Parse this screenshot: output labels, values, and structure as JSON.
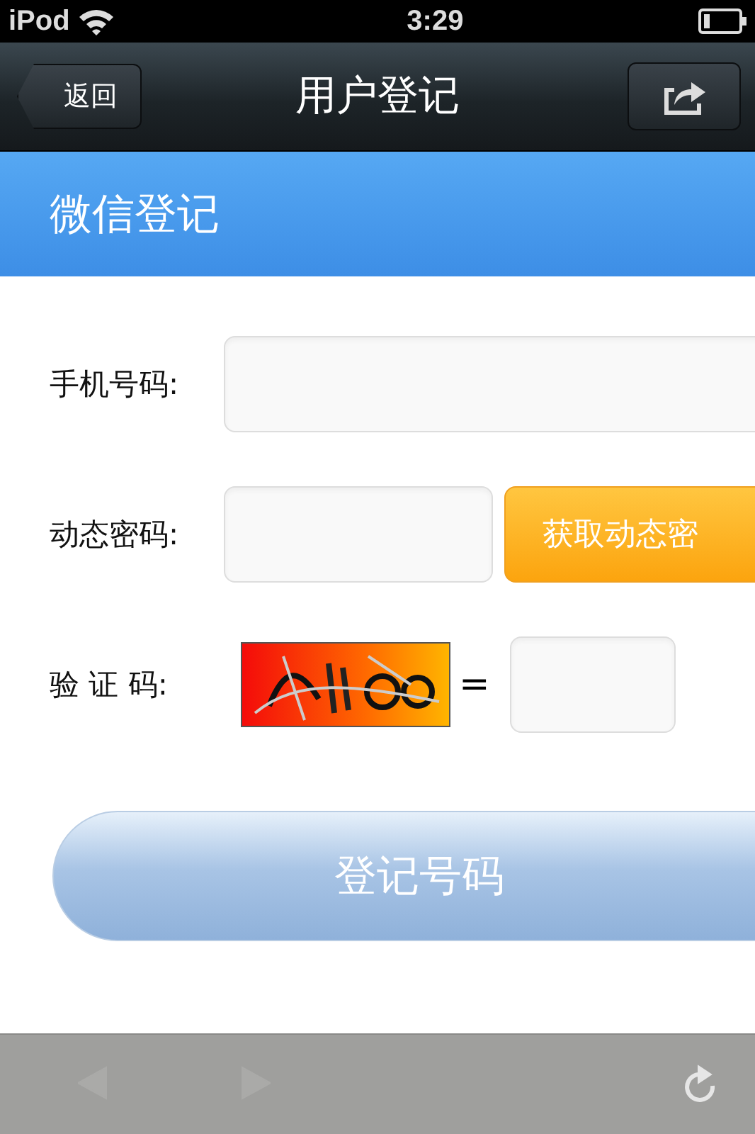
{
  "status_bar": {
    "carrier": "iPod",
    "time": "3:29"
  },
  "nav_bar": {
    "back_label": "返回",
    "title": "用户登记"
  },
  "header": {
    "title": "微信登记"
  },
  "form": {
    "phone_label": "手机号码:",
    "code_label": "动态密码:",
    "get_code_button": "获取动态密",
    "captcha_label": "验 证 码:",
    "equals": "=",
    "submit_button": "登记号码"
  },
  "toolbar": [
    {
      "kind": "back",
      "disabled": true
    },
    {
      "kind": "forward",
      "disabled": true
    },
    {
      "kind": "reload",
      "disabled": false
    }
  ]
}
